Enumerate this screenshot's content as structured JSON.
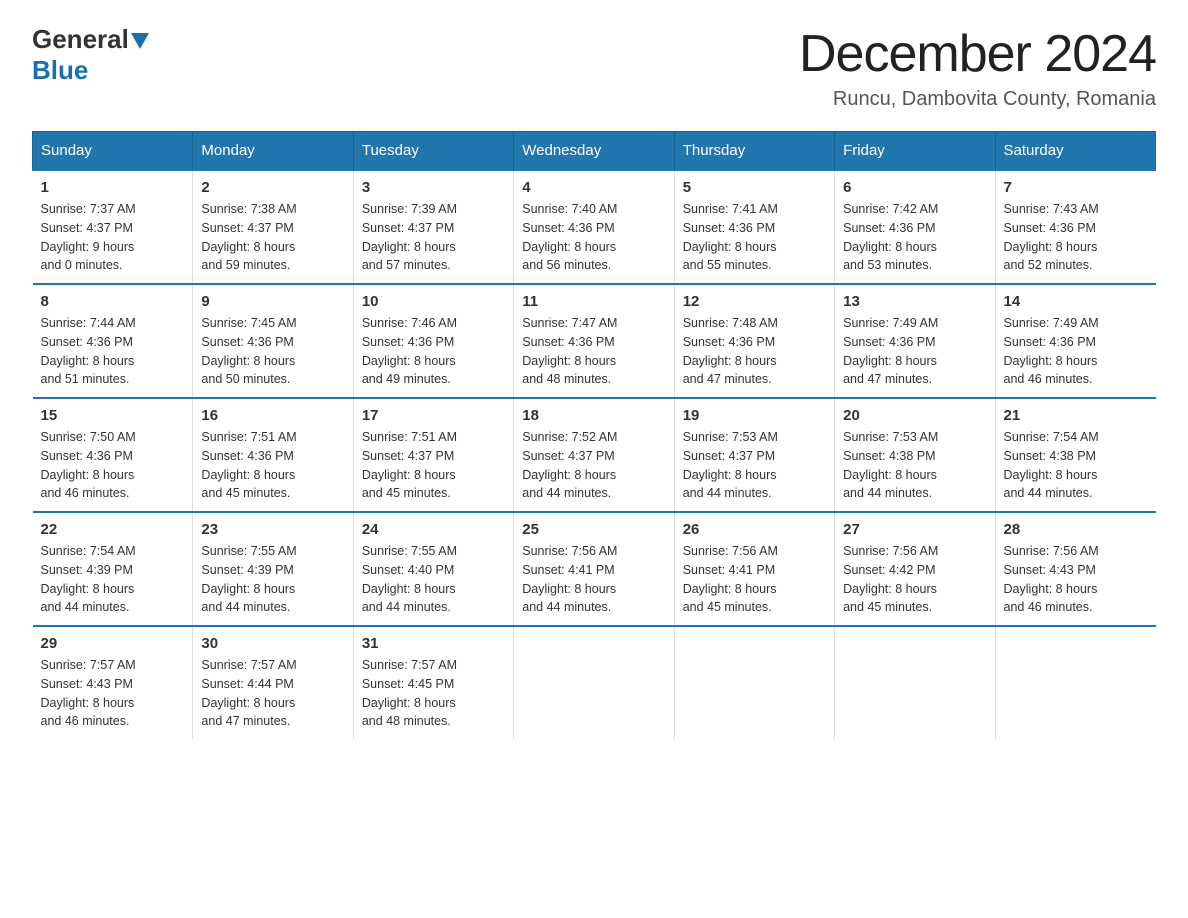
{
  "logo": {
    "general": "General",
    "blue": "Blue"
  },
  "title": "December 2024",
  "location": "Runcu, Dambovita County, Romania",
  "days_of_week": [
    "Sunday",
    "Monday",
    "Tuesday",
    "Wednesday",
    "Thursday",
    "Friday",
    "Saturday"
  ],
  "weeks": [
    [
      {
        "day": "1",
        "sunrise": "7:37 AM",
        "sunset": "4:37 PM",
        "daylight": "9 hours and 0 minutes."
      },
      {
        "day": "2",
        "sunrise": "7:38 AM",
        "sunset": "4:37 PM",
        "daylight": "8 hours and 59 minutes."
      },
      {
        "day": "3",
        "sunrise": "7:39 AM",
        "sunset": "4:37 PM",
        "daylight": "8 hours and 57 minutes."
      },
      {
        "day": "4",
        "sunrise": "7:40 AM",
        "sunset": "4:36 PM",
        "daylight": "8 hours and 56 minutes."
      },
      {
        "day": "5",
        "sunrise": "7:41 AM",
        "sunset": "4:36 PM",
        "daylight": "8 hours and 55 minutes."
      },
      {
        "day": "6",
        "sunrise": "7:42 AM",
        "sunset": "4:36 PM",
        "daylight": "8 hours and 53 minutes."
      },
      {
        "day": "7",
        "sunrise": "7:43 AM",
        "sunset": "4:36 PM",
        "daylight": "8 hours and 52 minutes."
      }
    ],
    [
      {
        "day": "8",
        "sunrise": "7:44 AM",
        "sunset": "4:36 PM",
        "daylight": "8 hours and 51 minutes."
      },
      {
        "day": "9",
        "sunrise": "7:45 AM",
        "sunset": "4:36 PM",
        "daylight": "8 hours and 50 minutes."
      },
      {
        "day": "10",
        "sunrise": "7:46 AM",
        "sunset": "4:36 PM",
        "daylight": "8 hours and 49 minutes."
      },
      {
        "day": "11",
        "sunrise": "7:47 AM",
        "sunset": "4:36 PM",
        "daylight": "8 hours and 48 minutes."
      },
      {
        "day": "12",
        "sunrise": "7:48 AM",
        "sunset": "4:36 PM",
        "daylight": "8 hours and 47 minutes."
      },
      {
        "day": "13",
        "sunrise": "7:49 AM",
        "sunset": "4:36 PM",
        "daylight": "8 hours and 47 minutes."
      },
      {
        "day": "14",
        "sunrise": "7:49 AM",
        "sunset": "4:36 PM",
        "daylight": "8 hours and 46 minutes."
      }
    ],
    [
      {
        "day": "15",
        "sunrise": "7:50 AM",
        "sunset": "4:36 PM",
        "daylight": "8 hours and 46 minutes."
      },
      {
        "day": "16",
        "sunrise": "7:51 AM",
        "sunset": "4:36 PM",
        "daylight": "8 hours and 45 minutes."
      },
      {
        "day": "17",
        "sunrise": "7:51 AM",
        "sunset": "4:37 PM",
        "daylight": "8 hours and 45 minutes."
      },
      {
        "day": "18",
        "sunrise": "7:52 AM",
        "sunset": "4:37 PM",
        "daylight": "8 hours and 44 minutes."
      },
      {
        "day": "19",
        "sunrise": "7:53 AM",
        "sunset": "4:37 PM",
        "daylight": "8 hours and 44 minutes."
      },
      {
        "day": "20",
        "sunrise": "7:53 AM",
        "sunset": "4:38 PM",
        "daylight": "8 hours and 44 minutes."
      },
      {
        "day": "21",
        "sunrise": "7:54 AM",
        "sunset": "4:38 PM",
        "daylight": "8 hours and 44 minutes."
      }
    ],
    [
      {
        "day": "22",
        "sunrise": "7:54 AM",
        "sunset": "4:39 PM",
        "daylight": "8 hours and 44 minutes."
      },
      {
        "day": "23",
        "sunrise": "7:55 AM",
        "sunset": "4:39 PM",
        "daylight": "8 hours and 44 minutes."
      },
      {
        "day": "24",
        "sunrise": "7:55 AM",
        "sunset": "4:40 PM",
        "daylight": "8 hours and 44 minutes."
      },
      {
        "day": "25",
        "sunrise": "7:56 AM",
        "sunset": "4:41 PM",
        "daylight": "8 hours and 44 minutes."
      },
      {
        "day": "26",
        "sunrise": "7:56 AM",
        "sunset": "4:41 PM",
        "daylight": "8 hours and 45 minutes."
      },
      {
        "day": "27",
        "sunrise": "7:56 AM",
        "sunset": "4:42 PM",
        "daylight": "8 hours and 45 minutes."
      },
      {
        "day": "28",
        "sunrise": "7:56 AM",
        "sunset": "4:43 PM",
        "daylight": "8 hours and 46 minutes."
      }
    ],
    [
      {
        "day": "29",
        "sunrise": "7:57 AM",
        "sunset": "4:43 PM",
        "daylight": "8 hours and 46 minutes."
      },
      {
        "day": "30",
        "sunrise": "7:57 AM",
        "sunset": "4:44 PM",
        "daylight": "8 hours and 47 minutes."
      },
      {
        "day": "31",
        "sunrise": "7:57 AM",
        "sunset": "4:45 PM",
        "daylight": "8 hours and 48 minutes."
      },
      null,
      null,
      null,
      null
    ]
  ],
  "labels": {
    "sunrise": "Sunrise:",
    "sunset": "Sunset:",
    "daylight": "Daylight:"
  }
}
